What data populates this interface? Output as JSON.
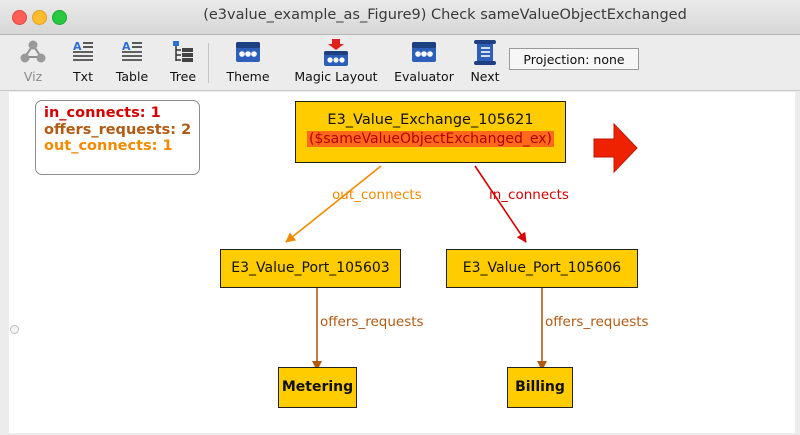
{
  "window": {
    "title": "(e3value_example_as_Figure9) Check sameValueObjectExchanged",
    "traffic_lights": {
      "close": "#ff5f57",
      "minimize": "#febc2e",
      "zoom": "#28c840"
    }
  },
  "toolbar": {
    "buttons": [
      {
        "label": "Viz",
        "icon": "viz-graph-icon",
        "enabled": false
      },
      {
        "label": "Txt",
        "icon": "text-view-icon",
        "enabled": true
      },
      {
        "label": "Table",
        "icon": "table-view-icon",
        "enabled": true
      },
      {
        "label": "Tree",
        "icon": "tree-view-icon",
        "enabled": true
      },
      {
        "label": "Theme",
        "icon": "theme-icon",
        "enabled": true
      },
      {
        "label": "Magic Layout",
        "icon": "magic-layout-icon",
        "enabled": true
      },
      {
        "label": "Evaluator",
        "icon": "evaluator-icon",
        "enabled": true
      },
      {
        "label": "Next",
        "icon": "next-scroll-icon",
        "enabled": true
      }
    ],
    "projection": "Projection: none"
  },
  "graph": {
    "legend": [
      {
        "text": "in_connects: 1",
        "color": "#d40000"
      },
      {
        "text": "offers_requests: 2",
        "color": "#b25a12"
      },
      {
        "text": "out_connects: 1",
        "color": "#f08a00"
      }
    ],
    "nodes": {
      "exchange": {
        "name": "E3_Value_Exchange_105621",
        "tag": "($sameValueObjectExchanged_ex)"
      },
      "port_left": {
        "name": "E3_Value_Port_105603"
      },
      "port_right": {
        "name": "E3_Value_Port_105606"
      },
      "metering": {
        "name": "Metering"
      },
      "billing": {
        "name": "Billing"
      }
    },
    "edges": {
      "out_connects": "out_connects",
      "in_connects": "in_connects",
      "offers_requests_left": "offers_requests",
      "offers_requests_right": "offers_requests"
    },
    "colors": {
      "node_fill": "#ffcc00",
      "out_connects": "#f08a00",
      "in_connects": "#d40000",
      "offers_requests": "#b25a12",
      "highlight_tag": "#ff6a1a",
      "arrow": "#ee2200"
    }
  }
}
